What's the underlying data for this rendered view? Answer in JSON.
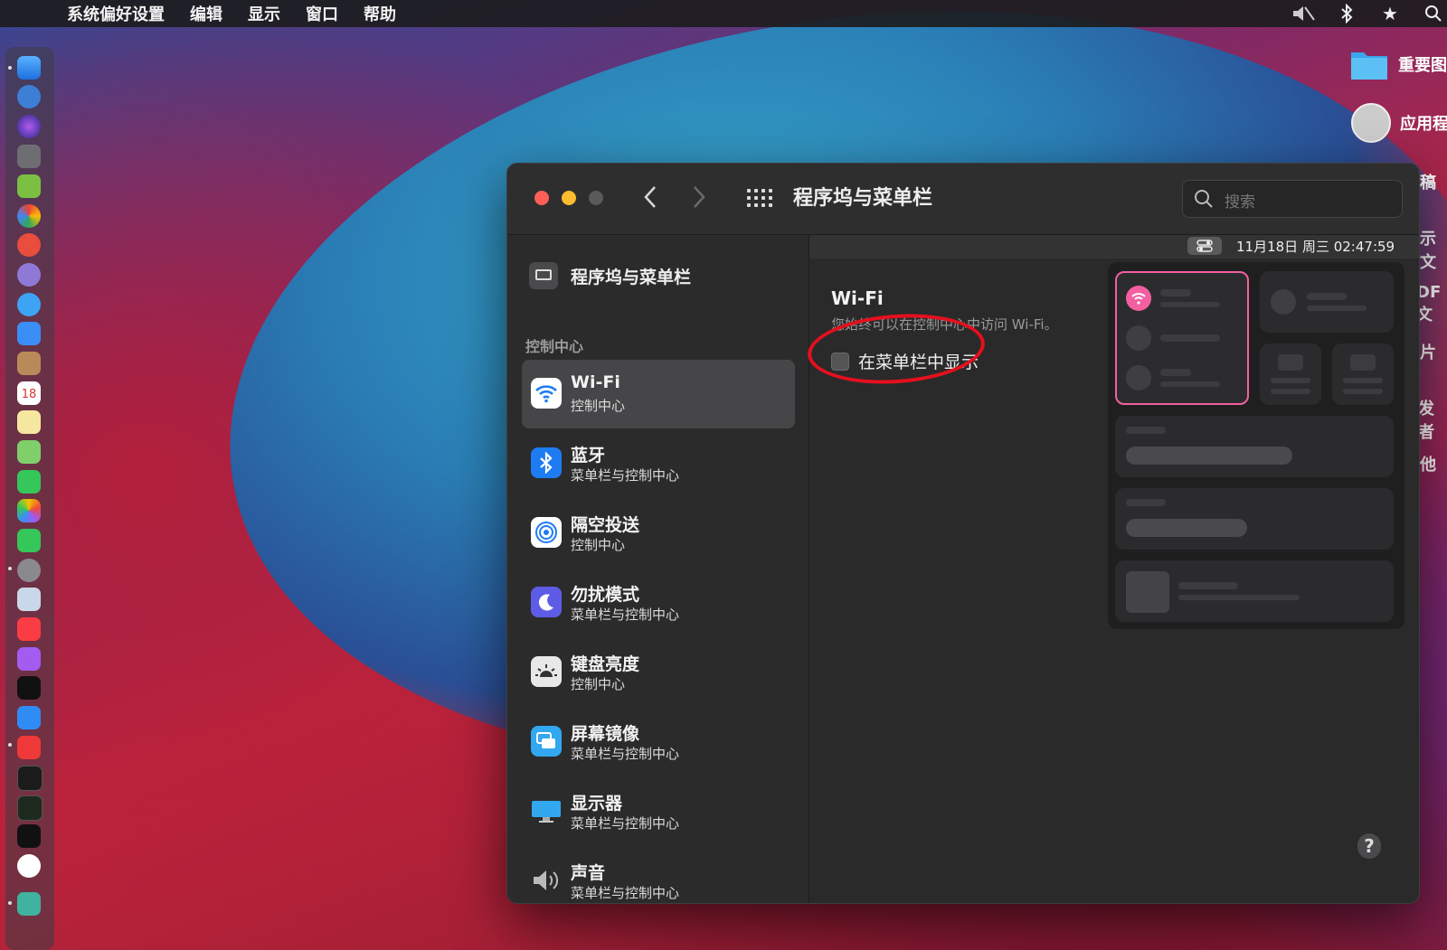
{
  "menubar": {
    "app_name": "系统偏好设置",
    "items": [
      "编辑",
      "显示",
      "窗口",
      "帮助"
    ]
  },
  "desktop": {
    "items": [
      {
        "label": "重要图",
        "icon": "folder-icon"
      },
      {
        "label": "应用程",
        "icon": "app-icon"
      }
    ],
    "fragments": [
      "稿",
      "示文",
      "DF文",
      "片",
      "发者",
      "他"
    ]
  },
  "window": {
    "title": "程序坞与菜单栏",
    "search_placeholder": "搜索",
    "status_clock": "11月18日 周三  02:47:59",
    "sidebar": {
      "top_item": "程序坞与菜单栏",
      "section_header": "控制中心",
      "items": [
        {
          "title": "Wi-Fi",
          "subtitle": "控制中心",
          "icon": "wifi-icon",
          "color": "#ffffff",
          "selected": true
        },
        {
          "title": "蓝牙",
          "subtitle": "菜单栏与控制中心",
          "icon": "bluetooth-icon",
          "color": "#1e7cf2"
        },
        {
          "title": "隔空投送",
          "subtitle": "控制中心",
          "icon": "airdrop-icon",
          "color": "#ffffff"
        },
        {
          "title": "勿扰模式",
          "subtitle": "菜单栏与控制中心",
          "icon": "moon-icon",
          "color": "#5e5ce6"
        },
        {
          "title": "键盘亮度",
          "subtitle": "控制中心",
          "icon": "keyboard-brightness-icon",
          "color": "#e8e8e8"
        },
        {
          "title": "屏幕镜像",
          "subtitle": "菜单栏与控制中心",
          "icon": "screen-mirroring-icon",
          "color": "#32a8f0"
        },
        {
          "title": "显示器",
          "subtitle": "菜单栏与控制中心",
          "icon": "display-icon",
          "color": "#32a8f0"
        },
        {
          "title": "声音",
          "subtitle": "菜单栏与控制中心",
          "icon": "speaker-icon",
          "color": "#2b2b2c"
        }
      ]
    },
    "detail": {
      "heading": "Wi-Fi",
      "description": "您始终可以在控制中心中访问 Wi-Fi。",
      "checkbox_label": "在菜单栏中显示",
      "checkbox_checked": false,
      "help_label": "?"
    }
  },
  "colors": {
    "highlight_pink": "#f35fa0",
    "annotation_red": "#e5101e"
  }
}
